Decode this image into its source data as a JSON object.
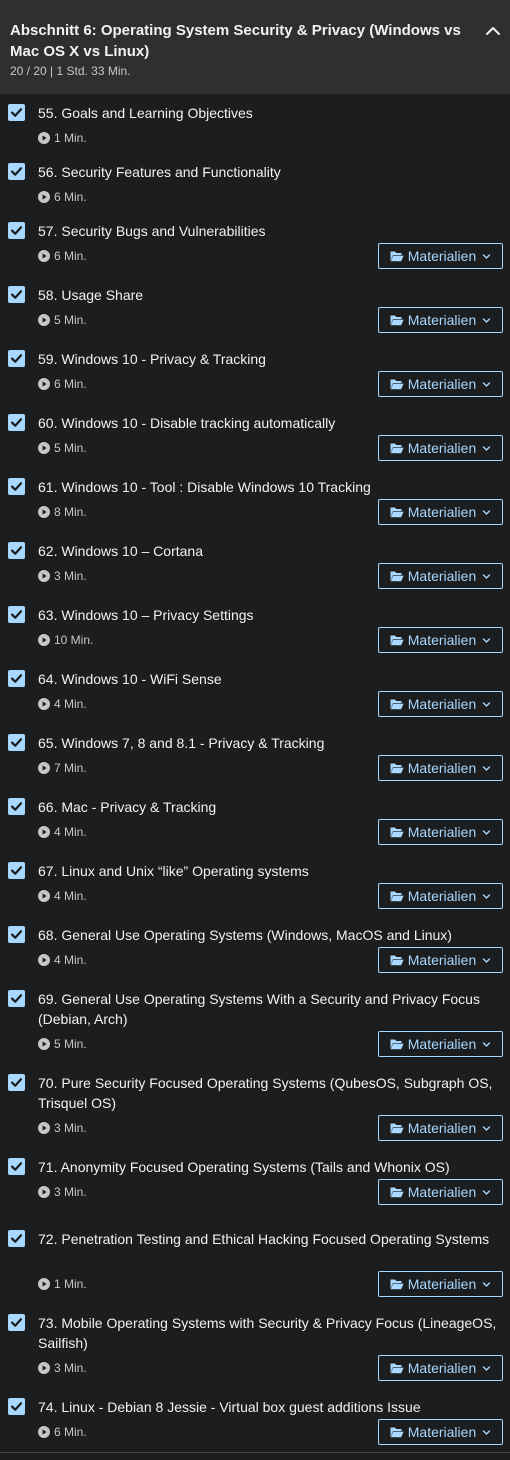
{
  "section": {
    "title": "Abschnitt 6: Operating System Security & Privacy (Windows vs Mac OS X vs Linux)",
    "meta": "20 / 20 | 1 Std. 33 Min.",
    "collapse_icon": "chevron-up-icon"
  },
  "colors": {
    "accent": "#a8d8ff",
    "header_bg": "#2d2f31",
    "page_bg": "#1b1d1f",
    "muted_text": "#c6c7c9"
  },
  "lectures": [
    {
      "title": "55. Goals and Learning Objectives",
      "duration": "1 Min.",
      "completed": true,
      "has_materials": false
    },
    {
      "title": "56. Security Features and Functionality",
      "duration": "6 Min.",
      "completed": true,
      "has_materials": false
    },
    {
      "title": "57. Security Bugs and Vulnerabilities",
      "duration": "6 Min.",
      "completed": true,
      "has_materials": true,
      "materials_label": "Materialien"
    },
    {
      "title": "58. Usage Share",
      "duration": "5 Min.",
      "completed": true,
      "has_materials": true,
      "materials_label": "Materialien"
    },
    {
      "title": "59. Windows 10 - Privacy & Tracking",
      "duration": "6 Min.",
      "completed": true,
      "has_materials": true,
      "materials_label": "Materialien"
    },
    {
      "title": "60. Windows 10 - Disable tracking automatically",
      "duration": "5 Min.",
      "completed": true,
      "has_materials": true,
      "materials_label": "Materialien"
    },
    {
      "title": "61. Windows 10 - Tool : Disable Windows 10 Tracking",
      "duration": "8 Min.",
      "completed": true,
      "has_materials": true,
      "materials_label": "Materialien"
    },
    {
      "title": "62. Windows 10 – Cortana",
      "duration": "3 Min.",
      "completed": true,
      "has_materials": true,
      "materials_label": "Materialien"
    },
    {
      "title": "63. Windows 10 – Privacy Settings",
      "duration": "10 Min.",
      "completed": true,
      "has_materials": true,
      "materials_label": "Materialien"
    },
    {
      "title": "64. Windows 10 - WiFi Sense",
      "duration": "4 Min.",
      "completed": true,
      "has_materials": true,
      "materials_label": "Materialien"
    },
    {
      "title": "65. Windows 7, 8 and 8.1 - Privacy & Tracking",
      "duration": "7 Min.",
      "completed": true,
      "has_materials": true,
      "materials_label": "Materialien"
    },
    {
      "title": "66. Mac - Privacy & Tracking",
      "duration": "4 Min.",
      "completed": true,
      "has_materials": true,
      "materials_label": "Materialien"
    },
    {
      "title": "67. Linux and Unix “like” Operating systems",
      "duration": "4 Min.",
      "completed": true,
      "has_materials": true,
      "materials_label": "Materialien"
    },
    {
      "title": "68. General Use Operating Systems (Windows, MacOS and Linux)",
      "duration": "4 Min.",
      "completed": true,
      "has_materials": true,
      "materials_label": "Materialien"
    },
    {
      "title": "69. General Use Operating Systems With a Security and Privacy Focus (Debian, Arch)",
      "duration": "5 Min.",
      "completed": true,
      "has_materials": true,
      "materials_label": "Materialien"
    },
    {
      "title": "70. Pure Security Focused Operating Systems (QubesOS, Subgraph OS, Trisquel OS)",
      "duration": "3 Min.",
      "completed": true,
      "has_materials": true,
      "materials_label": "Materialien"
    },
    {
      "title": "71. Anonymity Focused Operating Systems (Tails and Whonix OS)",
      "duration": "3 Min.",
      "completed": true,
      "has_materials": true,
      "materials_label": "Materialien"
    },
    {
      "title": "72. Penetration Testing and Ethical Hacking Focused Operating Systems",
      "duration": "1 Min.",
      "completed": true,
      "has_materials": true,
      "materials_label": "Materialien"
    },
    {
      "title": "73. Mobile Operating Systems with Security & Privacy Focus (LineageOS, Sailfish)",
      "duration": "3 Min.",
      "completed": true,
      "has_materials": true,
      "materials_label": "Materialien"
    },
    {
      "title": "74. Linux - Debian 8 Jessie - Virtual box guest additions Issue",
      "duration": "6 Min.",
      "completed": true,
      "has_materials": true,
      "materials_label": "Materialien"
    }
  ]
}
